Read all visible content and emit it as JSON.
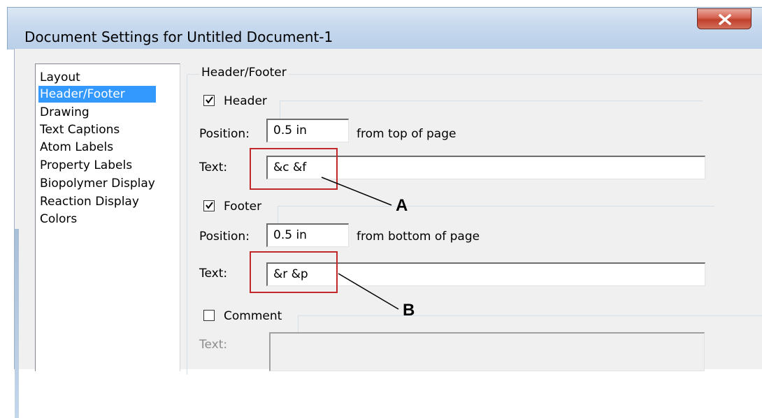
{
  "window": {
    "title": "Document Settings for Untitled Document-1",
    "close_icon": "close-x-icon",
    "close_color": "#c9452f"
  },
  "sidebar": {
    "items": [
      {
        "label": "Layout",
        "selected": false
      },
      {
        "label": "Header/Footer",
        "selected": true
      },
      {
        "label": "Drawing",
        "selected": false
      },
      {
        "label": "Text Captions",
        "selected": false
      },
      {
        "label": "Atom Labels",
        "selected": false
      },
      {
        "label": "Property Labels",
        "selected": false
      },
      {
        "label": "Biopolymer Display",
        "selected": false
      },
      {
        "label": "Reaction Display",
        "selected": false
      },
      {
        "label": "Colors",
        "selected": false
      }
    ]
  },
  "panel": {
    "group_title": "Header/Footer",
    "header": {
      "checkbox_label": "Header",
      "checked": true,
      "position_label": "Position:",
      "position_value": "0.5 in",
      "position_suffix": "from top of page",
      "text_label": "Text:",
      "text_value": "&c &f"
    },
    "footer": {
      "checkbox_label": "Footer",
      "checked": true,
      "position_label": "Position:",
      "position_value": "0.5 in",
      "position_suffix": "from bottom of page",
      "text_label": "Text:",
      "text_value": "&r &p"
    },
    "comment": {
      "checkbox_label": "Comment",
      "checked": false,
      "text_label": "Text:",
      "text_value": ""
    }
  },
  "annotations": {
    "a": "A",
    "b": "B",
    "highlight_color": "#c0282a"
  }
}
